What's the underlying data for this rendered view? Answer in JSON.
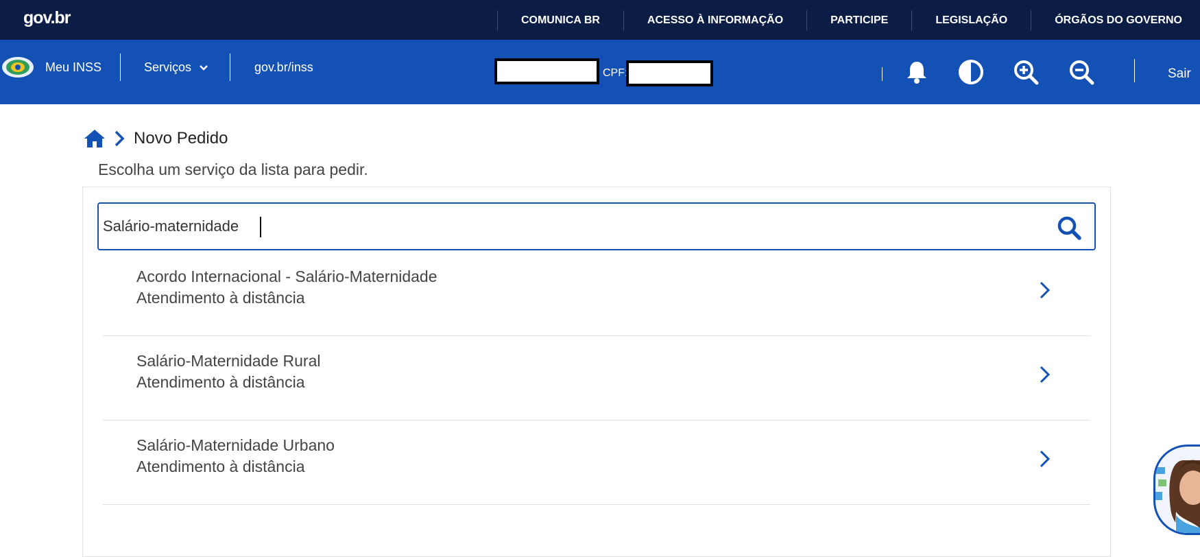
{
  "govbar": {
    "logo": "gov.br",
    "links": [
      "COMUNICA BR",
      "ACESSO À INFORMAÇÃO",
      "PARTICIPE",
      "LEGISLAÇÃO",
      "ÓRGÃOS DO GOVERNO"
    ]
  },
  "header": {
    "meu_inss": "Meu INSS",
    "servicos": "Serviços",
    "site": "gov.br/inss",
    "cpf_label": "CPF:",
    "sair": "Sair",
    "icons": [
      "bell-icon",
      "contrast-icon",
      "zoom-in-icon",
      "zoom-out-icon"
    ]
  },
  "breadcrumb": {
    "title": "Novo Pedido"
  },
  "subtitle": "Escolha um serviço da lista para pedir.",
  "search": {
    "value": "Salário-maternidade"
  },
  "results": [
    {
      "name": "Acordo Internacional - Salário-Maternidade",
      "mode": "Atendimento à distância"
    },
    {
      "name": "Salário-Maternidade Rural",
      "mode": "Atendimento à distância"
    },
    {
      "name": "Salário-Maternidade Urbano",
      "mode": "Atendimento à distância"
    }
  ],
  "colors": {
    "govbar_bg": "#0c1d45",
    "header_bg": "#1351b4",
    "accent": "#1351b4"
  }
}
